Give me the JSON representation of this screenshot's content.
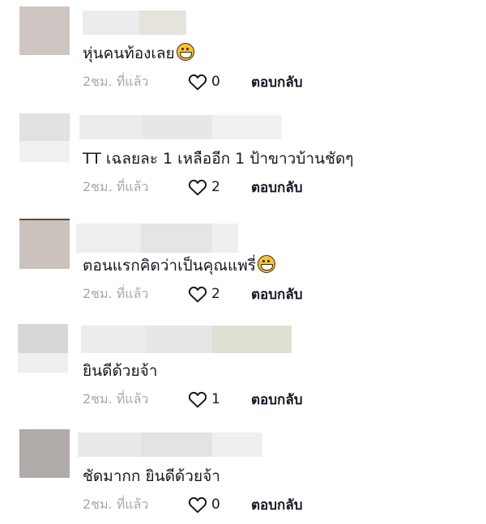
{
  "comments": [
    {
      "text": "หุ่นคนท้องเลย",
      "emoji": "grinning-face-emoji",
      "time": "2ชม. ที่แล้ว",
      "likes": "0",
      "reply_label": "ตอบกลับ"
    },
    {
      "text": "TT เฉลยละ 1 เหลืออีก 1 ป้าขาวบ้านชัดๆ",
      "emoji": "",
      "time": "2ชม. ที่แล้ว",
      "likes": "2",
      "reply_label": "ตอบกลับ"
    },
    {
      "text": "ตอนแรกคิดว่าเป็นคุณแพรี่",
      "emoji": "grinning-face-emoji",
      "time": "2ชม. ที่แล้ว",
      "likes": "2",
      "reply_label": "ตอบกลับ"
    },
    {
      "text": "ยินดีด้วยจ้า",
      "emoji": "",
      "time": "2ชม. ที่แล้ว",
      "likes": "1",
      "reply_label": "ตอบกลับ"
    },
    {
      "text": "ชัดมากก ยินดีด้วยจ้า",
      "emoji": "",
      "time": "2ชม. ที่แล้ว",
      "likes": "0",
      "reply_label": "ตอบกลับ"
    }
  ],
  "icons": {
    "like": "heart-outline-icon",
    "emoji": "grinning-face-emoji"
  },
  "colors": {
    "text": "#161823",
    "meta": "#a7a8ad",
    "emoji_fill": "#f7c23a"
  }
}
